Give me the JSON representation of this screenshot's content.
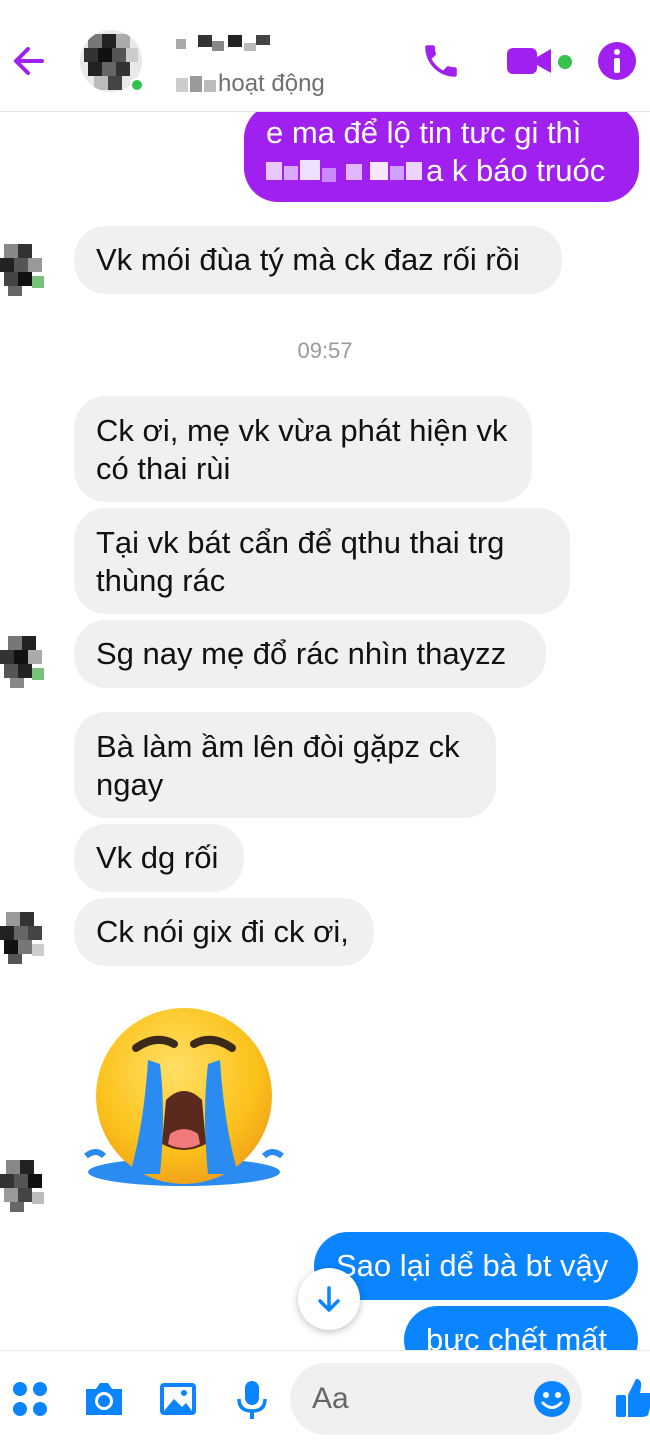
{
  "header": {
    "status": "hoạt động"
  },
  "messages": {
    "m1": "e ma  để lộ tin tưc gi thì",
    "m1b": "a k báo truóc",
    "m2": "Vk mói đùa tý mà ck đaz rối rồi",
    "timestamp": "09:57",
    "m3a": "Ck ơi, mẹ vk vừa phát hiện vk",
    "m3b": "có thai rùi",
    "m4a": "Tại vk bát cẩn để qthu thai trg",
    "m4b": "thùng rác",
    "m5": "Sg nay mẹ đổ rác  nhìn thayzz",
    "m6a": "Bà làm ầm lên đòi gặpz ck",
    "m6b": "ngay",
    "m7": "Vk dg rối",
    "m8": "Ck nói gix đi ck ơi,",
    "m9": "Sao lại dể bà bt vậy",
    "m10": "bưc chết mất"
  },
  "composer": {
    "placeholder": "Aa"
  },
  "colors": {
    "accent": "#a020f0",
    "outgoing_blue": "#0a84ff",
    "incoming_bg": "#f0f0f0",
    "online": "#35c24a"
  },
  "icons": [
    "back-arrow-icon",
    "phone-icon",
    "video-call-icon",
    "info-icon",
    "crying-face-emoji",
    "scroll-down-icon",
    "apps-icon",
    "camera-icon",
    "gallery-icon",
    "mic-icon",
    "emoji-icon",
    "thumbs-up-icon"
  ]
}
